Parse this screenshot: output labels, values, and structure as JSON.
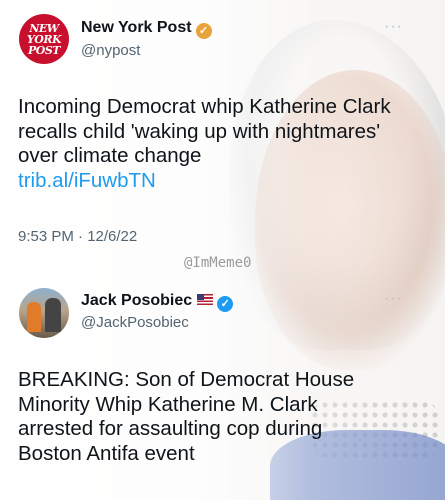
{
  "tweets": [
    {
      "avatar_text": [
        "NEW",
        "YORK",
        "POST"
      ],
      "name": "New York Post",
      "handle": "@nypost",
      "verified_color": "#e8a33a",
      "more": "···",
      "text": "Incoming Democrat whip Katherine Clark recalls child 'waking up with nightmares' over climate change",
      "link": "trib.al/iFuwbTN",
      "time": "9:53 PM · 12/6/22"
    },
    {
      "name": "Jack Posobiec",
      "handle": "@JackPosobiec",
      "verified_color": "#1d9bf0",
      "flag": "us-flag-icon",
      "more": "···",
      "text": "BREAKING: Son of Democrat House Minority Whip Katherine M. Clark arrested for assaulting cop during Boston Antifa event"
    }
  ],
  "watermark": "@ImMeme0",
  "colors": {
    "link": "#1d9bf0",
    "brand_red": "#c8102e"
  }
}
